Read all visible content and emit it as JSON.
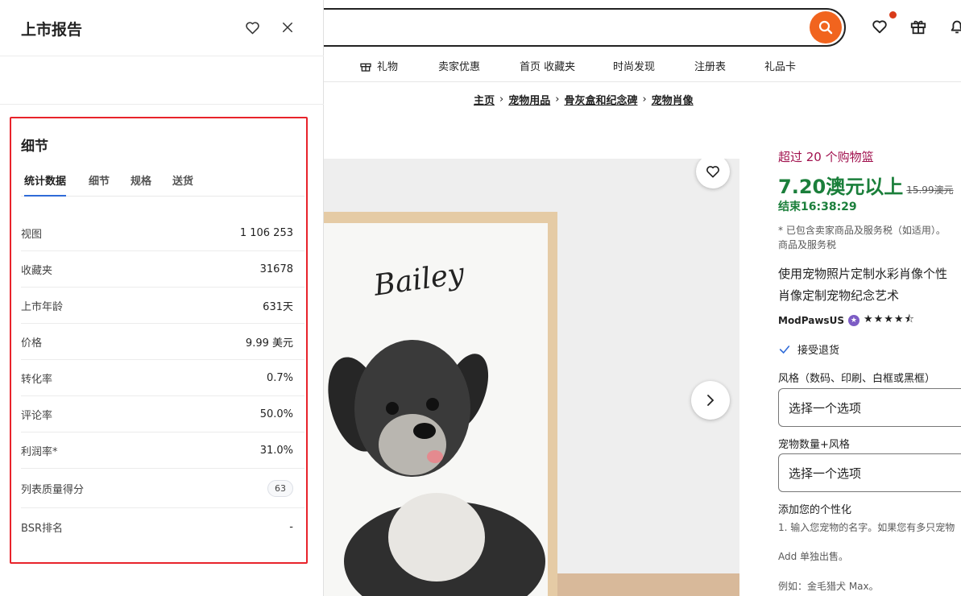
{
  "panel": {
    "title": "上市报告",
    "details_title": "细节",
    "tabs": [
      {
        "label": "统计数据",
        "active": true
      },
      {
        "label": "细节",
        "active": false
      },
      {
        "label": "规格",
        "active": false
      },
      {
        "label": "送货",
        "active": false
      }
    ],
    "rows": [
      {
        "label": "视图",
        "value": "1 106 253"
      },
      {
        "label": "收藏夹",
        "value": "31678"
      },
      {
        "label": "上市年龄",
        "value": "631天"
      },
      {
        "label": "价格",
        "value": "9.99 美元"
      },
      {
        "label": "转化率",
        "value": "0.7%"
      },
      {
        "label": "评论率",
        "value": "50.0%"
      },
      {
        "label": "利润率*",
        "value": "31.0%"
      },
      {
        "label": "列表质量得分",
        "value": "63"
      },
      {
        "label": "BSR排名",
        "value": "-"
      }
    ],
    "highlight_color": "#e8232b",
    "tab_accent": "#2f6bd8"
  },
  "nav": {
    "categories": [
      "礼物",
      "卖家优惠",
      "首页 收藏夹",
      "时尚发现",
      "注册表",
      "礼品卡"
    ],
    "breadcrumb": [
      "主页",
      "宠物用品",
      "骨灰盒和纪念碑",
      "宠物肖像"
    ],
    "search_color": "#f1641e"
  },
  "product": {
    "basket_text": "超过 20 个购物篮",
    "price": "7.20澳元以上",
    "original_price": "15.99澳元",
    "ends": "结束16:38:29",
    "tax_note_1": "* 已包含卖家商品及服务税（如适用）。",
    "tax_note_2": "商品及服务税",
    "title_line_1": "使用宠物照片定制水彩肖像个性",
    "title_line_2": "肖像定制宠物纪念艺术",
    "shop": "ModPaws​US",
    "rating": 4.5,
    "returns": "接受退货",
    "style_label": "风格（数码、印刷、白框或黑框）",
    "select_placeholder_1": "选择一个选项",
    "qty_label": "宠物数量+风格",
    "select_placeholder_2": "选择一个选项",
    "personalize_label": "添加您的个性化",
    "personalize_note": "1. 输入您宠物的名字。如果您有多只宠物",
    "add_note": "Add 单独出售。",
    "example": "例如：金毛猎犬 Max。",
    "pet_name": "Bailey",
    "price_color": "#1b7f3b",
    "basket_color": "#a1114e"
  }
}
